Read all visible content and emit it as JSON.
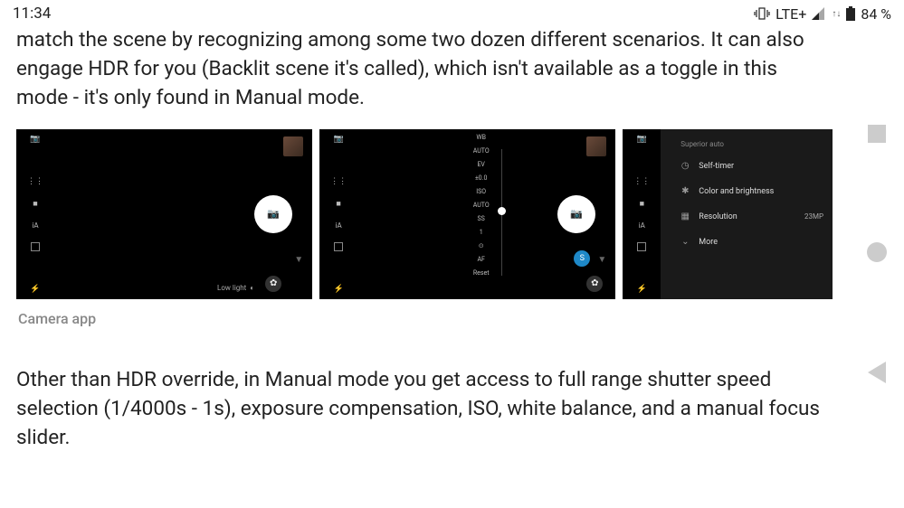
{
  "status": {
    "time": "11:34",
    "network": "LTE+",
    "battery": "84 %"
  },
  "article": {
    "para1": "match the scene by recognizing among some two dozen different scenarios. It can also engage HDR for you (Backlit scene it's called), which isn't available as a toggle in this mode - it's only found in Manual mode.",
    "caption": "Camera app",
    "para2": "Other than HDR override, in Manual mode you get access to full range shutter speed selection (1/4000s - 1s), exposure compensation, ISO, white balance, and a manual focus slider."
  },
  "shots": {
    "s1": {
      "low_light": "Low light"
    },
    "s2": {
      "labels": {
        "wb": "WB",
        "auto1": "AUTO",
        "ev": "EV",
        "ev_val": "±0.0",
        "iso": "ISO",
        "auto2": "AUTO",
        "ss": "SS",
        "ss_val": "1",
        "focus": "⊙",
        "af": "AF",
        "reset": "Reset"
      }
    },
    "s3": {
      "title": "Superior auto",
      "items": {
        "selftimer": "Self-timer",
        "color": "Color and brightness",
        "resolution": "Resolution",
        "res_val": "23MP",
        "more": "More"
      }
    }
  }
}
